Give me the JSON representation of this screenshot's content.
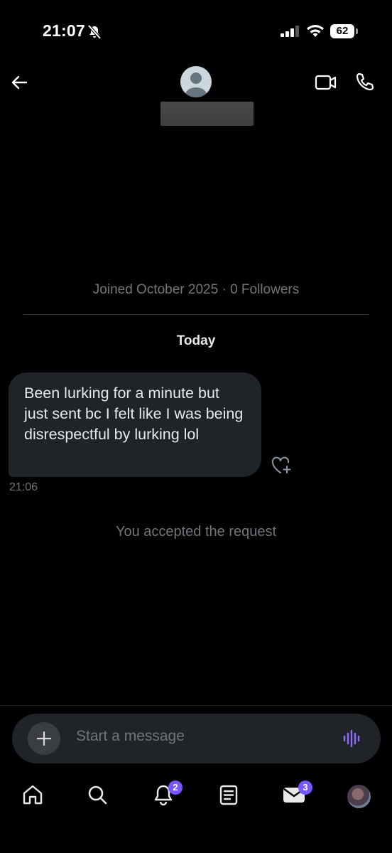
{
  "status_bar": {
    "time": "21:07",
    "battery": "62"
  },
  "header": {
    "back_icon": "arrow-left-icon",
    "avatar_icon": "default-avatar-icon",
    "video_icon": "video-call-icon",
    "phone_icon": "phone-call-icon"
  },
  "profile": {
    "joined_text": "Joined October 2025 · 0 Followers"
  },
  "conversation": {
    "date_separator": "Today",
    "messages": [
      {
        "text": "Been lurking for a minute but just sent bc I felt like I was being disrespectful by lurking lol",
        "time": "21:06"
      }
    ],
    "system_note": "You accepted the request"
  },
  "composer": {
    "placeholder": "Start a message",
    "add_icon": "plus-icon",
    "voice_icon": "voice-waveform-icon"
  },
  "tabbar": {
    "tabs": [
      {
        "icon": "home-icon"
      },
      {
        "icon": "search-icon"
      },
      {
        "icon": "bell-icon",
        "badge": "2"
      },
      {
        "icon": "article-icon"
      },
      {
        "icon": "mail-icon",
        "badge": "3"
      },
      {
        "icon": "profile-avatar"
      }
    ]
  },
  "colors": {
    "background": "#000000",
    "bubble": "#202327",
    "muted": "#71767b",
    "accent": "#7856ff"
  }
}
